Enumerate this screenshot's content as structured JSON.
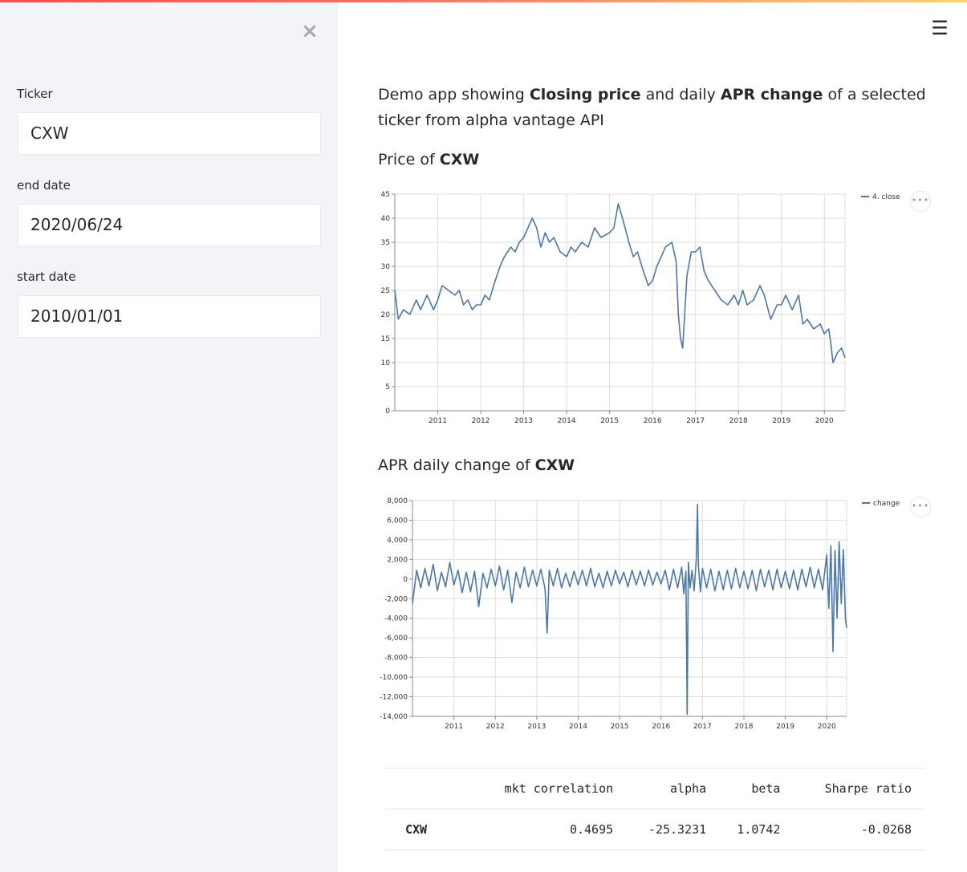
{
  "sidebar": {
    "close_icon": "×",
    "fields": [
      {
        "label": "Ticker",
        "value": "CXW"
      },
      {
        "label": "end date",
        "value": "2020/06/24"
      },
      {
        "label": "start date",
        "value": "2010/01/01"
      }
    ]
  },
  "header": {
    "menu_icon": "☰"
  },
  "intro": {
    "part1": "Demo app showing ",
    "bold1": "Closing price",
    "part2": " and daily ",
    "bold2": "APR change",
    "part3": " of a selected ticker from alpha vantage API"
  },
  "price_section": {
    "prefix": "Price of ",
    "ticker": "CXW"
  },
  "change_section": {
    "prefix": "APR daily change of ",
    "ticker": "CXW"
  },
  "more_icon": "•••",
  "colors": {
    "series": "#4c78a8",
    "grid": "#dddddd",
    "sidebar_bg": "#f3f4f7"
  },
  "chart_data": [
    {
      "type": "line",
      "legend": [
        "4. close"
      ],
      "legend_position": "top-right",
      "grid": true,
      "x_ticks": [
        "2011",
        "2012",
        "2013",
        "2014",
        "2015",
        "2016",
        "2017",
        "2018",
        "2019",
        "2020"
      ],
      "xlim": [
        2010.0,
        2020.48
      ],
      "ylim": [
        0,
        45
      ],
      "y_ticks": [
        "0",
        "5",
        "10",
        "15",
        "20",
        "25",
        "30",
        "35",
        "40",
        "45"
      ],
      "series": [
        {
          "name": "4. close",
          "x": [
            2010.0,
            2010.08,
            2010.2,
            2010.35,
            2010.5,
            2010.6,
            2010.75,
            2010.9,
            2011.0,
            2011.1,
            2011.25,
            2011.4,
            2011.5,
            2011.6,
            2011.7,
            2011.8,
            2011.9,
            2012.0,
            2012.1,
            2012.2,
            2012.3,
            2012.45,
            2012.55,
            2012.7,
            2012.8,
            2012.9,
            2013.0,
            2013.1,
            2013.2,
            2013.3,
            2013.4,
            2013.5,
            2013.6,
            2013.7,
            2013.85,
            2014.0,
            2014.1,
            2014.2,
            2014.35,
            2014.5,
            2014.65,
            2014.8,
            2015.0,
            2015.1,
            2015.2,
            2015.3,
            2015.45,
            2015.55,
            2015.65,
            2015.75,
            2015.9,
            2016.0,
            2016.1,
            2016.2,
            2016.3,
            2016.45,
            2016.55,
            2016.6,
            2016.65,
            2016.7,
            2016.8,
            2016.9,
            2017.0,
            2017.1,
            2017.2,
            2017.3,
            2017.45,
            2017.6,
            2017.75,
            2017.9,
            2018.0,
            2018.1,
            2018.2,
            2018.35,
            2018.5,
            2018.6,
            2018.75,
            2018.9,
            2019.0,
            2019.1,
            2019.25,
            2019.4,
            2019.5,
            2019.6,
            2019.75,
            2019.9,
            2020.0,
            2020.1,
            2020.15,
            2020.2,
            2020.3,
            2020.4,
            2020.48
          ],
          "values": [
            25,
            19,
            21,
            20,
            23,
            21,
            24,
            21,
            23,
            26,
            25,
            24,
            25,
            22,
            23,
            21,
            22,
            22,
            24,
            23,
            26,
            30,
            32,
            34,
            33,
            35,
            36,
            38,
            40,
            38,
            34,
            37,
            35,
            36,
            33,
            32,
            34,
            33,
            35,
            34,
            38,
            36,
            37,
            38,
            43,
            40,
            35,
            32,
            33,
            30,
            26,
            27,
            30,
            32,
            34,
            35,
            31,
            20,
            15,
            13,
            28,
            33,
            33,
            34,
            29,
            27,
            25,
            23,
            22,
            24,
            22,
            25,
            22,
            23,
            26,
            24,
            19,
            22,
            22,
            24,
            21,
            24,
            18,
            19,
            17,
            18,
            16,
            17,
            14,
            10,
            12,
            13,
            11
          ]
        }
      ]
    },
    {
      "type": "line",
      "legend": [
        "change"
      ],
      "legend_position": "top-right",
      "grid": true,
      "x_ticks": [
        "2011",
        "2012",
        "2013",
        "2014",
        "2015",
        "2016",
        "2017",
        "2018",
        "2019",
        "2020"
      ],
      "xlim": [
        2010.0,
        2020.48
      ],
      "ylim": [
        -14000,
        8000
      ],
      "y_ticks": [
        "-14,000",
        "-12,000",
        "-10,000",
        "-8,000",
        "-6,000",
        "-4,000",
        "-2,000",
        "0",
        "2,000",
        "4,000",
        "6,000",
        "8,000"
      ],
      "series": [
        {
          "name": "change",
          "x": [
            2010.0,
            2010.1,
            2010.2,
            2010.3,
            2010.4,
            2010.5,
            2010.6,
            2010.7,
            2010.8,
            2010.9,
            2011.0,
            2011.1,
            2011.2,
            2011.3,
            2011.4,
            2011.5,
            2011.6,
            2011.7,
            2011.8,
            2011.9,
            2012.0,
            2012.1,
            2012.2,
            2012.3,
            2012.4,
            2012.5,
            2012.6,
            2012.7,
            2012.8,
            2012.9,
            2013.0,
            2013.1,
            2013.2,
            2013.25,
            2013.3,
            2013.4,
            2013.5,
            2013.6,
            2013.7,
            2013.8,
            2013.9,
            2014.0,
            2014.1,
            2014.2,
            2014.3,
            2014.4,
            2014.5,
            2014.6,
            2014.7,
            2014.8,
            2014.9,
            2015.0,
            2015.1,
            2015.2,
            2015.3,
            2015.4,
            2015.5,
            2015.6,
            2015.7,
            2015.8,
            2015.9,
            2016.0,
            2016.1,
            2016.2,
            2016.3,
            2016.4,
            2016.5,
            2016.55,
            2016.6,
            2016.63,
            2016.66,
            2016.7,
            2016.75,
            2016.8,
            2016.85,
            2016.88,
            2016.9,
            2016.95,
            2017.0,
            2017.1,
            2017.2,
            2017.3,
            2017.4,
            2017.5,
            2017.6,
            2017.7,
            2017.8,
            2017.9,
            2018.0,
            2018.1,
            2018.2,
            2018.3,
            2018.4,
            2018.5,
            2018.6,
            2018.7,
            2018.8,
            2018.9,
            2019.0,
            2019.1,
            2019.2,
            2019.3,
            2019.4,
            2019.5,
            2019.6,
            2019.7,
            2019.8,
            2019.9,
            2020.0,
            2020.05,
            2020.1,
            2020.15,
            2020.2,
            2020.25,
            2020.3,
            2020.35,
            2020.4,
            2020.45,
            2020.48
          ],
          "values": [
            -2500,
            900,
            -900,
            1100,
            -700,
            1500,
            -1200,
            700,
            -800,
            1700,
            -600,
            900,
            -1400,
            700,
            -1300,
            800,
            -2800,
            600,
            -900,
            1000,
            -700,
            1300,
            -1100,
            900,
            -2400,
            700,
            -900,
            1200,
            -800,
            900,
            -700,
            1000,
            -1000,
            -5500,
            900,
            -700,
            1100,
            -900,
            600,
            -800,
            800,
            -600,
            900,
            -700,
            1100,
            -800,
            600,
            -900,
            800,
            -700,
            900,
            -500,
            700,
            -800,
            900,
            -600,
            800,
            -700,
            900,
            -600,
            700,
            -500,
            900,
            -1100,
            1000,
            -900,
            1200,
            -1500,
            800,
            -13800,
            1700,
            -900,
            900,
            -1200,
            2000,
            7600,
            1500,
            -1300,
            1100,
            -900,
            1000,
            -1200,
            800,
            -1100,
            900,
            -1000,
            1100,
            -900,
            800,
            -1000,
            900,
            -1200,
            1000,
            -800,
            900,
            -1100,
            1000,
            -900,
            800,
            -1000,
            900,
            -1100,
            1000,
            -800,
            1200,
            -900,
            1000,
            -1100,
            2500,
            -3000,
            3400,
            -7400,
            2900,
            -4000,
            3800,
            -2500,
            3000,
            -4000,
            -5000
          ]
        }
      ]
    }
  ],
  "stats_table": {
    "headers": [
      "",
      "mkt correlation",
      "alpha",
      "beta",
      "Sharpe ratio"
    ],
    "rows": [
      {
        "ticker": "CXW",
        "mkt_correlation": "0.4695",
        "alpha": "-25.3231",
        "beta": "1.0742",
        "sharpe": "-0.0268"
      }
    ]
  }
}
